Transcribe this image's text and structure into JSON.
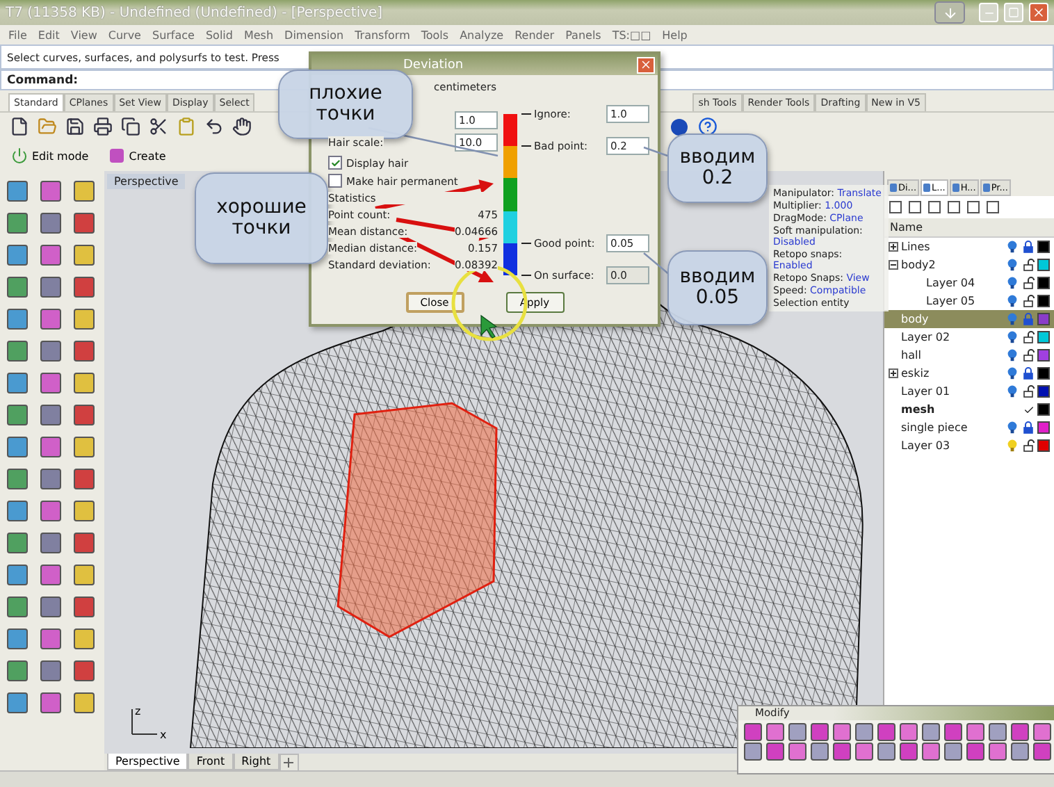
{
  "window": {
    "title": "T7 (11358 KB) - Undefined (Undefined) - [Perspective]"
  },
  "menu": [
    "File",
    "Edit",
    "View",
    "Curve",
    "Surface",
    "Solid",
    "Mesh",
    "Dimension",
    "Transform",
    "Tools",
    "Analyze",
    "Render",
    "Panels",
    "TS:□□",
    "Help"
  ],
  "command_history": "Select curves, surfaces, and polysurfs to test. Press",
  "command": {
    "label": "Command:"
  },
  "toolbar_tabs_left": [
    {
      "label": "Standard",
      "selected": true
    },
    {
      "label": "CPlanes",
      "selected": false
    },
    {
      "label": "Set View",
      "selected": false
    },
    {
      "label": "Display",
      "selected": false
    },
    {
      "label": "Select",
      "selected": false
    }
  ],
  "toolbar_tabs_right": [
    {
      "label": "sh Tools",
      "selected": false
    },
    {
      "label": "Render Tools",
      "selected": false
    },
    {
      "label": "Drafting",
      "selected": false
    },
    {
      "label": "New in V5",
      "selected": false
    }
  ],
  "edit_bar": [
    "Edit mode",
    "Create"
  ],
  "viewport": {
    "title": "Perspective",
    "axis_labels": [
      "z",
      "x"
    ],
    "tabs": [
      {
        "label": "Perspective",
        "selected": true
      },
      {
        "label": "Front",
        "selected": false
      },
      {
        "label": "Right",
        "selected": false
      }
    ]
  },
  "properties": [
    {
      "label": "Manipulator:",
      "value": "Translate"
    },
    {
      "label": "Multiplier:",
      "value": "1.000"
    },
    {
      "label": "DragMode:",
      "value": "CPlane"
    },
    {
      "label": "Soft manipulation:",
      "value": "Disabled"
    },
    {
      "label": "Retopo snaps:",
      "value": "Enabled"
    },
    {
      "label": "Retopo Snaps:",
      "value": "View"
    },
    {
      "label": "Speed:",
      "value": "Compatible"
    },
    {
      "label": "Selection entity"
    }
  ],
  "dialog": {
    "title": "Deviation",
    "note": "centimeters",
    "proximity_value": "1.0",
    "hair_scale": {
      "label": "Hair scale:",
      "value": "10.0"
    },
    "checkboxes": [
      {
        "label": "Display hair",
        "checked": true
      },
      {
        "label": "Make hair permanent",
        "checked": false
      }
    ],
    "statistics_title": "Statistics",
    "statistics": [
      {
        "label": "Point count:",
        "value": "475"
      },
      {
        "label": "Mean distance:",
        "value": "0.04666"
      },
      {
        "label": "Median distance:",
        "value": "0.157"
      },
      {
        "label": "Standard deviation:",
        "value": "0.08392"
      }
    ],
    "thresholds": [
      {
        "label": "Ignore:",
        "value": "1.0",
        "disabled": false
      },
      {
        "label": "Bad point:",
        "value": "0.2",
        "disabled": false
      },
      {
        "label": "Good point:",
        "value": "0.05",
        "disabled": false
      },
      {
        "label": "On surface:",
        "value": "0.0",
        "disabled": true
      }
    ],
    "buttons": [
      {
        "label": "Close",
        "kind": "default"
      },
      {
        "label": "Apply",
        "kind": "normal"
      }
    ]
  },
  "annotations": [
    "плохие точки",
    "хорошие точки",
    "вводим 0.2",
    "вводим 0.05"
  ],
  "layers_panel": {
    "tabs": [
      {
        "label": "Di...",
        "selected": false
      },
      {
        "label": "L...",
        "selected": true
      },
      {
        "label": "H...",
        "selected": false
      },
      {
        "label": "Pr...",
        "selected": false
      }
    ],
    "header": "Name",
    "layers": [
      {
        "name": "Lines",
        "expanded": false,
        "selected": false,
        "current": false,
        "visible": true,
        "locked": true,
        "color": "#000000"
      },
      {
        "name": "body2",
        "expanded": true,
        "selected": false,
        "current": false,
        "visible": true,
        "locked": false,
        "color": "#00c8d8",
        "children": [
          {
            "name": "Layer 04",
            "selected": false,
            "current": false,
            "visible": true,
            "locked": false,
            "color": "#000000"
          },
          {
            "name": "Layer 05",
            "selected": false,
            "current": false,
            "visible": true,
            "locked": false,
            "color": "#000000"
          }
        ]
      },
      {
        "name": "body",
        "selected": true,
        "current": false,
        "visible": true,
        "locked": true,
        "color": "#8a3cc8"
      },
      {
        "name": "Layer 02",
        "selected": false,
        "current": false,
        "visible": true,
        "locked": false,
        "color": "#00c8d8"
      },
      {
        "name": "hall",
        "selected": false,
        "current": false,
        "visible": true,
        "locked": false,
        "color": "#a040e0"
      },
      {
        "name": "eskiz",
        "expanded": false,
        "selected": false,
        "current": false,
        "visible": true,
        "locked": true,
        "color": "#000000"
      },
      {
        "name": "Layer 01",
        "selected": false,
        "current": false,
        "visible": true,
        "locked": false,
        "color": "#0010b0"
      },
      {
        "name": "mesh",
        "selected": false,
        "current": true,
        "color": "#000000"
      },
      {
        "name": "single piece",
        "selected": false,
        "current": false,
        "visible": true,
        "locked": true,
        "color": "#e020c8"
      },
      {
        "name": "Layer 03",
        "selected": false,
        "current": false,
        "visible": false,
        "locked": false,
        "color": "#e00000"
      }
    ]
  },
  "modify_toolbar": {
    "title": "Modify"
  }
}
